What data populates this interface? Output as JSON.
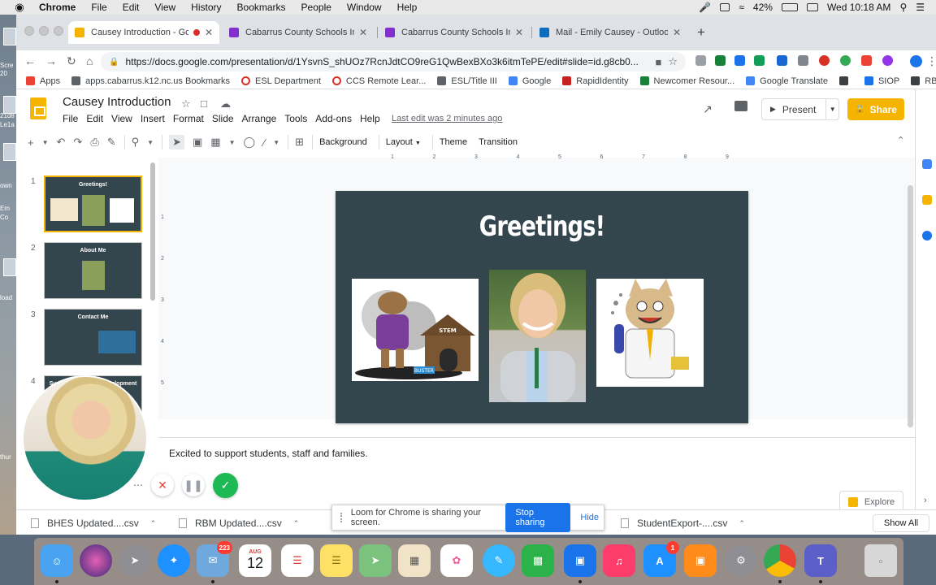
{
  "mac": {
    "app": "Chrome",
    "menus": [
      "File",
      "Edit",
      "View",
      "History",
      "Bookmarks",
      "People",
      "Window",
      "Help"
    ],
    "battery": "42%",
    "clock": "Wed 10:18 AM"
  },
  "desktop": {
    "labels": [
      "Scre",
      "20",
      "21d8",
      "Le1a",
      "own",
      "Em",
      "Co",
      "load",
      "thur"
    ]
  },
  "tabs": [
    {
      "title": "Causey Introduction - Goo",
      "active": true,
      "recording": true,
      "color": "#f4b400"
    },
    {
      "title": "Cabarrus County Schools Inter",
      "active": false,
      "color": "#8430ce"
    },
    {
      "title": "Cabarrus County Schools Inter",
      "active": false,
      "color": "#8430ce"
    },
    {
      "title": "Mail - Emily Causey - Outlook",
      "active": false,
      "color": "#0f6cbd"
    }
  ],
  "address": {
    "url": "https://docs.google.com/presentation/d/1YsvnS_shUOz7RcnJdtCO9reG1QwBexBXo3k6itmTePE/edit#slide=id.g8cb0..."
  },
  "bookmarks": [
    {
      "label": "Apps",
      "color": "#ea4335"
    },
    {
      "label": "apps.cabarrus.k12.nc.us Bookmarks",
      "color": "#5f6368"
    },
    {
      "label": "ESL Department",
      "color": "ring"
    },
    {
      "label": "CCS Remote Lear...",
      "color": "ring"
    },
    {
      "label": "ESL/Title III",
      "color": "#5f6368"
    },
    {
      "label": "Google",
      "color": "#4285f4"
    },
    {
      "label": "RapidIdentity",
      "color": "#c5221f"
    },
    {
      "label": "Newcomer Resour...",
      "color": "#188038"
    },
    {
      "label": "Google Translate",
      "color": "#4285f4"
    },
    {
      "label": "",
      "color": "#3c4043"
    },
    {
      "label": "SIOP",
      "color": "#1a73e8"
    },
    {
      "label": "RBM Staff",
      "color": "#3c4043"
    }
  ],
  "doc": {
    "title": "Causey Introduction",
    "menu": [
      "File",
      "Edit",
      "View",
      "Insert",
      "Format",
      "Slide",
      "Arrange",
      "Tools",
      "Add-ons",
      "Help"
    ],
    "last_edit": "Last edit was 2 minutes ago",
    "present": "Present",
    "share": "Share",
    "avatar": "E"
  },
  "toolbar": {
    "background": "Background",
    "layout": "Layout",
    "theme": "Theme",
    "transition": "Transition"
  },
  "ruler": {
    "top": [
      "1",
      "2",
      "3",
      "4",
      "5",
      "6",
      "7",
      "8",
      "9"
    ],
    "left": [
      "1",
      "2",
      "3",
      "4",
      "5"
    ]
  },
  "filmstrip": [
    {
      "num": "1",
      "title": "Greetings!"
    },
    {
      "num": "2",
      "title": "About Me"
    },
    {
      "num": "3",
      "title": "Contact Me"
    },
    {
      "num": "4",
      "title": "Support Language Development"
    }
  ],
  "slide": {
    "title": "Greetings!",
    "doghouse_text": "STEM",
    "dog_tag": "BUSTER"
  },
  "notes": {
    "text": "Excited to support students, staff and families.",
    "explore": "Explore"
  },
  "downloads": [
    {
      "name": "BHES Updated....csv"
    },
    {
      "name": "RBM Updated....csv"
    },
    {
      "name": "StudentExport-....csv"
    }
  ],
  "show_all": "Show All",
  "loom": {
    "message": "Loom for Chrome is sharing your screen.",
    "stop": "Stop sharing",
    "hide": "Hide"
  },
  "dock": {
    "calendar_month": "AUG",
    "calendar_day": "12",
    "mail_badge": "223",
    "appstore_badge": "1"
  }
}
